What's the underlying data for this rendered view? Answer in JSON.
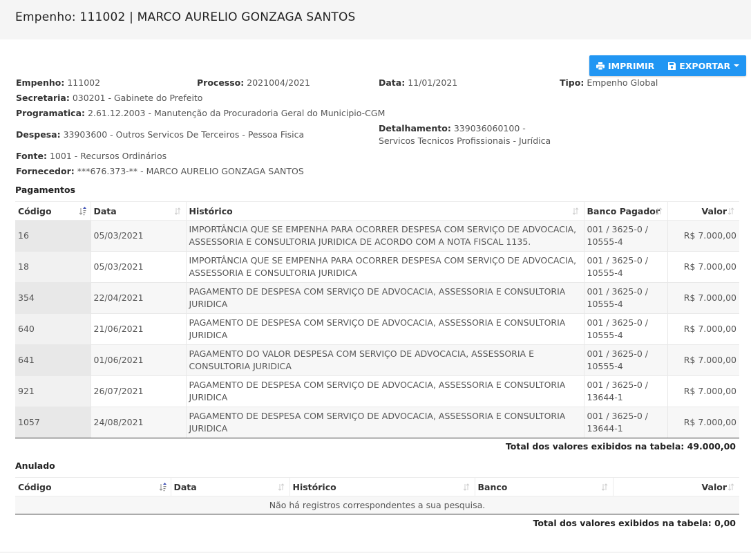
{
  "page": {
    "title": "Empenho: 111002 | MARCO AURELIO GONZAGA SANTOS"
  },
  "actions": {
    "print_label": "IMPRIMIR",
    "export_label": "EXPORTAR"
  },
  "details": {
    "empenho_label": "Empenho:",
    "empenho_value": "111002",
    "processo_label": "Processo:",
    "processo_value": "2021004/2021",
    "data_label": "Data:",
    "data_value": "11/01/2021",
    "tipo_label": "Tipo:",
    "tipo_value": "Empenho Global",
    "secretaria_label": "Secretaria:",
    "secretaria_value": "030201 - Gabinete do Prefeito",
    "programatica_label": "Programatica:",
    "programatica_value": "2.61.12.2003 - Manutenção da Procuradoria Geral do Municipio-CGM",
    "despesa_label": "Despesa:",
    "despesa_value": "33903600 - Outros Servicos De Terceiros - Pessoa Fisica",
    "detalhamento_label": "Detalhamento:",
    "detalhamento_value": "339036060100 -",
    "detalhamento_value_2": "Servicos Tecnicos Profissionais - Jurídica",
    "fonte_label": "Fonte:",
    "fonte_value": "1001 - Recursos Ordinários",
    "fornecedor_label": "Fornecedor:",
    "fornecedor_value": "***676.373-** - MARCO AURELIO GONZAGA SANTOS"
  },
  "pagamentos": {
    "title": "Pagamentos",
    "columns": [
      "Código",
      "Data",
      "Histórico",
      "Banco Pagador",
      "Valor"
    ],
    "rows": [
      {
        "codigo": "16",
        "data": "05/03/2021",
        "historico_1": "IMPORTÂNCIA QUE SE EMPENHA PARA OCORRER DESPESA COM SERVIÇO DE ADVOCACIA,",
        "historico_2": "ASSESSORIA E CONSULTORIA JURIDICA DE ACORDO COM A NOTA FISCAL 1135.",
        "banco_1": "001 / 3625-0 /",
        "banco_2": "10555-4",
        "valor": "R$ 7.000,00"
      },
      {
        "codigo": "18",
        "data": "05/03/2021",
        "historico_1": "IMPORTÂNCIA QUE SE EMPENHA PARA OCORRER DESPESA COM SERVIÇO DE ADVOCACIA,",
        "historico_2": "ASSESSORIA E CONSULTORIA JURIDICA",
        "banco_1": "001 / 3625-0 /",
        "banco_2": "10555-4",
        "valor": "R$ 7.000,00"
      },
      {
        "codigo": "354",
        "data": "22/04/2021",
        "historico_1": "PAGAMENTO DE DESPESA COM SERVIÇO DE ADVOCACIA, ASSESSORIA E CONSULTORIA",
        "historico_2": "JURIDICA",
        "banco_1": "001 / 3625-0 /",
        "banco_2": "10555-4",
        "valor": "R$ 7.000,00"
      },
      {
        "codigo": "640",
        "data": "21/06/2021",
        "historico_1": "PAGAMENTO DE DESPESA COM SERVIÇO DE ADVOCACIA, ASSESSORIA E CONSULTORIA",
        "historico_2": "JURIDICA",
        "banco_1": "001 / 3625-0 /",
        "banco_2": "10555-4",
        "valor": "R$ 7.000,00"
      },
      {
        "codigo": "641",
        "data": "01/06/2021",
        "historico_1": "PAGAMENTO DO VALOR DESPESA COM SERVIÇO DE ADVOCACIA, ASSESSORIA E",
        "historico_2": "CONSULTORIA JURIDICA",
        "banco_1": "001 / 3625-0 /",
        "banco_2": "10555-4",
        "valor": "R$ 7.000,00"
      },
      {
        "codigo": "921",
        "data": "26/07/2021",
        "historico_1": "PAGAMENTO DE DESPESA COM SERVIÇO DE ADVOCACIA, ASSESSORIA E CONSULTORIA",
        "historico_2": "JURIDICA",
        "banco_1": "001 / 3625-0 /",
        "banco_2": "13644-1",
        "valor": "R$ 7.000,00"
      },
      {
        "codigo": "1057",
        "data": "24/08/2021",
        "historico_1": "PAGAMENTO DE DESPESA COM SERVIÇO DE ADVOCACIA, ASSESSORIA E CONSULTORIA",
        "historico_2": "JURIDICA",
        "banco_1": "001 / 3625-0 /",
        "banco_2": "13644-1",
        "valor": "R$ 7.000,00"
      }
    ],
    "total": "Total dos valores exibidos na tabela: 49.000,00"
  },
  "anulado": {
    "title": "Anulado",
    "columns": [
      "Código",
      "Data",
      "Histórico",
      "Banco",
      "Valor"
    ],
    "empty_message": "Não há registros correspondentes a sua pesquisa.",
    "total": "Total dos valores exibidos na tabela: 0,00"
  },
  "colors": {
    "accent": "#2196f3",
    "header_bg": "#f5f5f5"
  }
}
